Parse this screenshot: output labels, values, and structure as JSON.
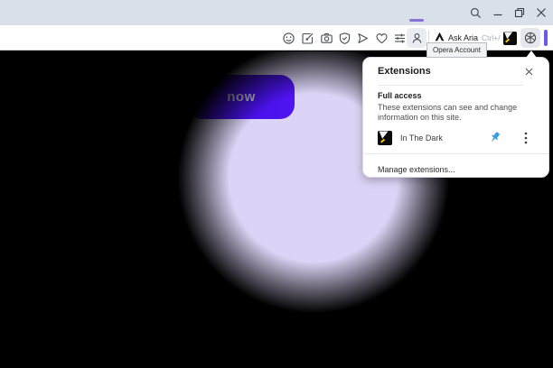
{
  "titlebar": {
    "icons": {
      "search": "magnifier",
      "minimize": "horizontal-line",
      "restore": "overlapping-squares",
      "close": "x-mark"
    }
  },
  "toolbar": {
    "ask_aria_label": "Ask Aria",
    "ask_aria_shortcut": "Ctrl+/",
    "icons": {
      "emoji": "smiley-face",
      "edit": "pencil-square",
      "camera": "camera",
      "shield": "shield-check",
      "send": "paper-plane-triangle",
      "favorites": "heart-outline",
      "tune": "slider-lines",
      "profile": "person-silhouette",
      "aria_logo": "aria-triangle",
      "in_the_dark_favicon": "black-square-yellow-spark",
      "extensions": "cube",
      "sidebar_indicator": "purple-vertical-bar"
    }
  },
  "tooltip": {
    "text": "Opera Account"
  },
  "extensions_popup": {
    "title": "Extensions",
    "section_heading": "Full access",
    "section_body": "These extensions can see and change information on this site.",
    "extension": {
      "name": "In The Dark",
      "icon": "black-square-yellow-spark",
      "pin_icon": "blue-pushpin",
      "menu_icon": "kebab-three-dots"
    },
    "manage_label": "Manage extensions..."
  },
  "page": {
    "cta_label": "now"
  },
  "colors": {
    "titlebar_bg": "#d9e0e9",
    "accent_underline": "#8474d8",
    "sidebar_bar": "#6a5ce8",
    "cta_indigo": "#4a11e9",
    "spotlight_lavender": "#dcd4f6",
    "pin_blue": "#3aa0dc"
  }
}
